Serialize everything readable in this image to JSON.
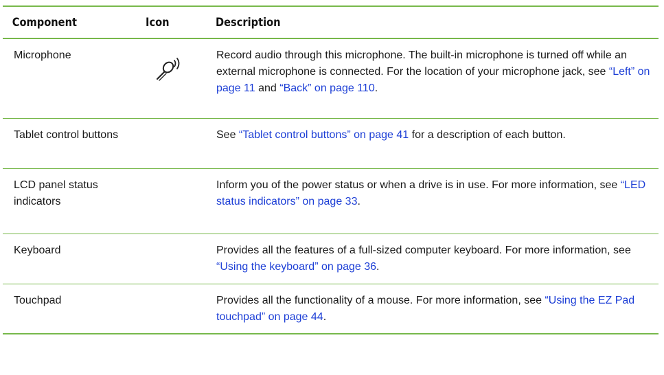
{
  "headers": {
    "component": "Component",
    "icon": "Icon",
    "description": "Description"
  },
  "rows": [
    {
      "component": "Microphone",
      "icon": "microphone-icon",
      "desc": {
        "t1": "Record audio through this microphone. The built-in microphone is turned off while an external microphone is connected. For the location of your microphone jack, see ",
        "link1": "“Left” on page 11",
        "t2": " and ",
        "link2": "“Back” on page 110",
        "t3": "."
      }
    },
    {
      "component": "Tablet control buttons",
      "desc": {
        "t1": "See ",
        "link1": "“Tablet control buttons” on page 41",
        "t2": " for a description of each button."
      }
    },
    {
      "component": "LCD panel status indicators",
      "desc": {
        "t1": "Inform you of the power status or when a drive is in use. For more information, see ",
        "link1": "“LED status indicators” on page 33",
        "t2": "."
      }
    },
    {
      "component": "Keyboard",
      "desc": {
        "t1": "Provides all the features of a full-sized computer keyboard. For more information, see ",
        "link1": "“Using the keyboard” on page 36",
        "t2": "."
      }
    },
    {
      "component": "Touchpad",
      "desc": {
        "t1": "Provides all the functionality of a mouse. For more information, see ",
        "link1": "“Using the EZ Pad touchpad” on page 44",
        "t2": "."
      }
    }
  ],
  "colors": {
    "rule": "#77b84a",
    "link": "#1d3fd6"
  }
}
